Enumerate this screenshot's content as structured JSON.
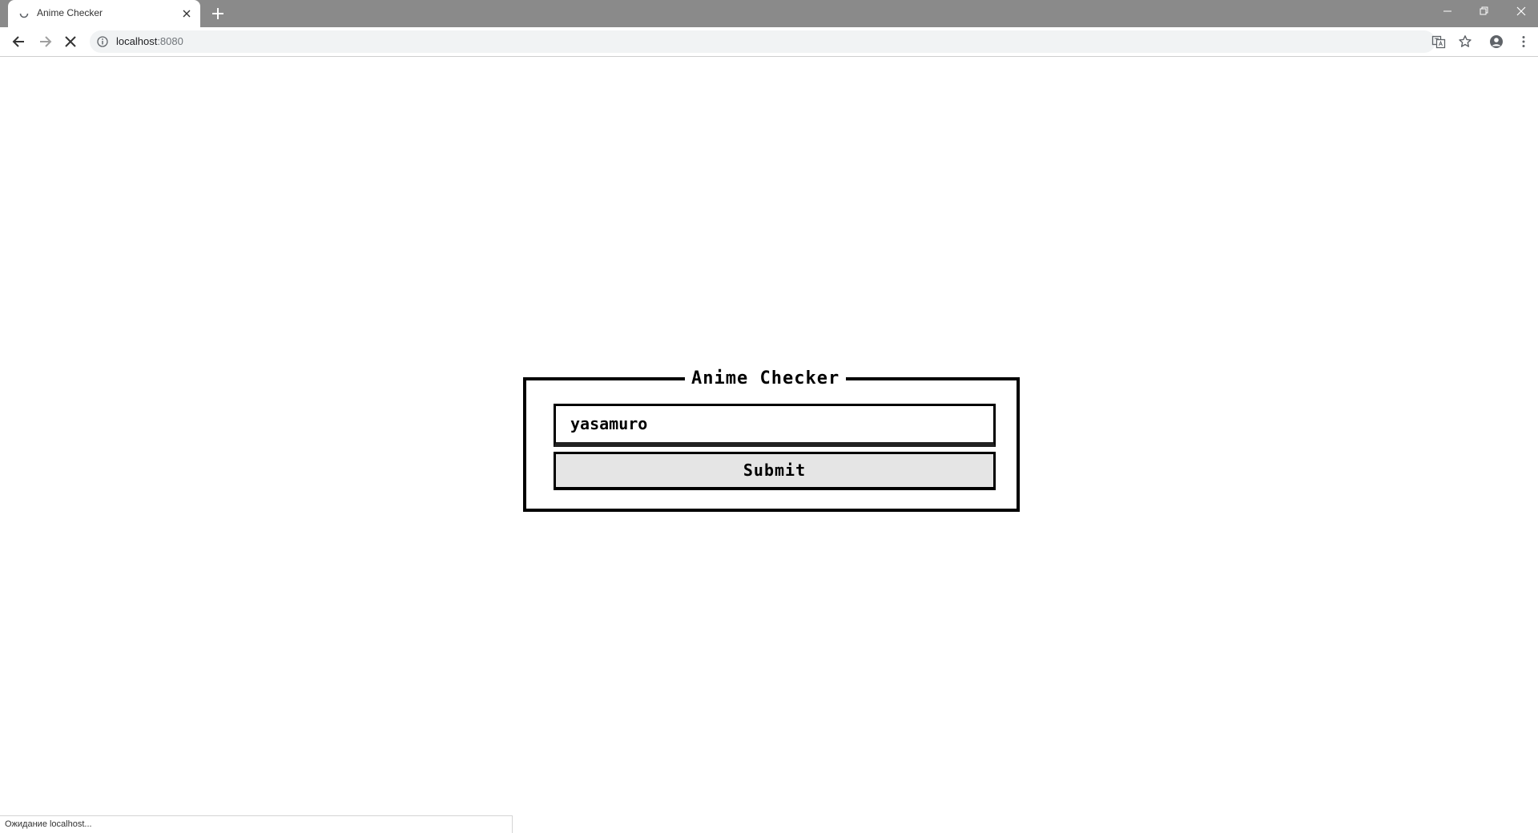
{
  "browser": {
    "tab": {
      "title": "Anime Checker"
    },
    "address_bar": {
      "host": "localhost",
      "port": ":8080"
    },
    "status_text": "Ожидание localhost..."
  },
  "page": {
    "form": {
      "legend": "Anime Checker",
      "username_value": "yasamuro",
      "submit_label": "Submit"
    }
  },
  "colors": {
    "tabstrip": "#8a8a8a",
    "omnibox": "#f1f3f4",
    "button_bg": "#e5e5e5",
    "border": "#000000"
  }
}
